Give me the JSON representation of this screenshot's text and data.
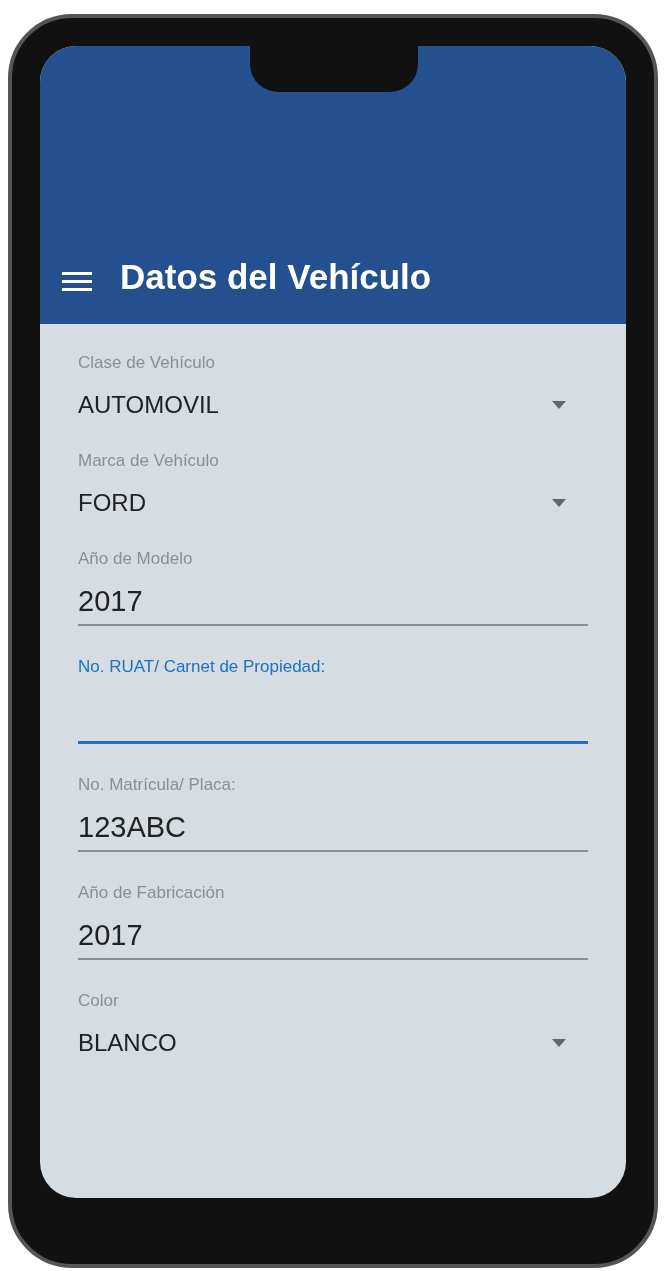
{
  "app_bar": {
    "title": "Datos del Vehículo"
  },
  "fields": [
    {
      "kind": "dropdown",
      "label": "Clase de Vehículo",
      "value": "AUTOMOVIL",
      "focused": false
    },
    {
      "kind": "dropdown",
      "label": "Marca de Vehículo",
      "value": "FORD",
      "focused": false
    },
    {
      "kind": "text",
      "label": "Año de Modelo",
      "value": "2017",
      "focused": false
    },
    {
      "kind": "text",
      "label": "No. RUAT/ Carnet de Propiedad:",
      "focused": true
    },
    {
      "kind": "text",
      "label": "No. Matrícula/ Placa:",
      "value": "123ABC",
      "focused": false
    },
    {
      "kind": "text",
      "label": "Año de Fabricación",
      "value": "2017",
      "focused": false
    },
    {
      "kind": "dropdown",
      "label": "Color",
      "value": "BLANCO",
      "focused": false
    }
  ]
}
